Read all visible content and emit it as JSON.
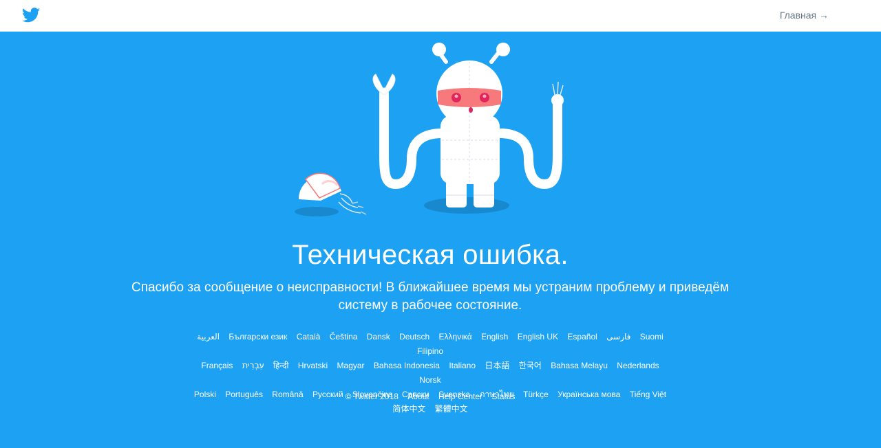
{
  "header": {
    "home_link": "Главная →"
  },
  "error": {
    "title": "Техническая ошибка.",
    "message": "Спасибо за сообщение о неисправности! В ближайшее время мы устраним проблему и приведём систему в рабочее состояние."
  },
  "languages": [
    "العربية",
    "Български език",
    "Català",
    "Čeština",
    "Dansk",
    "Deutsch",
    "Ελληνικά",
    "English",
    "English UK",
    "Español",
    "فارسی",
    "Suomi",
    "Filipino",
    "Français",
    "עִבְרִית",
    "हिन्दी",
    "Hrvatski",
    "Magyar",
    "Bahasa Indonesia",
    "Italiano",
    "日本語",
    "한국어",
    "Bahasa Melayu",
    "Nederlands",
    "Norsk",
    "Polski",
    "Português",
    "Română",
    "Русский",
    "Slovenčina",
    "Српски",
    "Svenska",
    "ภาษาไทย",
    "Türkçe",
    "Українська мова",
    "Tiếng Việt",
    "简体中文",
    "繁體中文"
  ],
  "footer": {
    "copyright": "© Twitter 2018",
    "about": "About",
    "help_center": "Help Center",
    "status": "Status"
  },
  "colors": {
    "background": "#1da1f2",
    "topbar": "#ffffff",
    "link_gray": "#657786",
    "robot_white": "#ffffff",
    "robot_mask": "#f7797b",
    "robot_eyes": "#e0245e"
  },
  "icons": {
    "logo": "twitter-bird-icon",
    "illustration": "broken-robot-illustration"
  }
}
